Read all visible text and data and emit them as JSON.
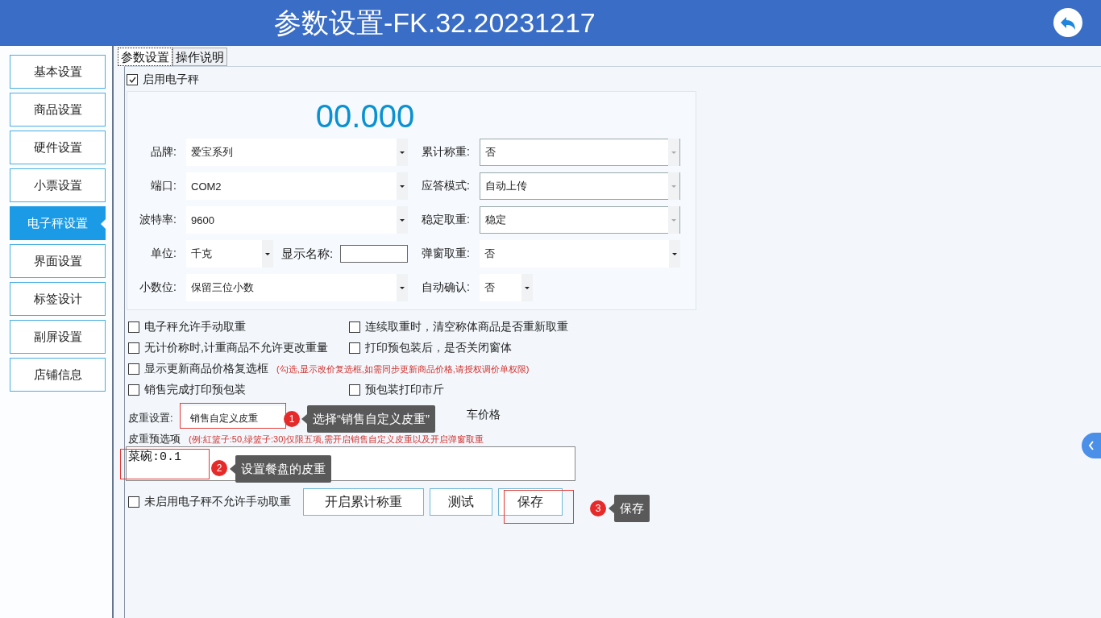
{
  "window": {
    "title": "参数设置-FK.32.20231217"
  },
  "sidebar": {
    "items": [
      {
        "label": "基本设置",
        "selected": false
      },
      {
        "label": "商品设置",
        "selected": false
      },
      {
        "label": "硬件设置",
        "selected": false
      },
      {
        "label": "小票设置",
        "selected": false
      },
      {
        "label": "电子秤设置",
        "selected": true
      },
      {
        "label": "界面设置",
        "selected": false
      },
      {
        "label": "标签设计",
        "selected": false
      },
      {
        "label": "副屏设置",
        "selected": false
      },
      {
        "label": "店铺信息",
        "selected": false
      }
    ]
  },
  "tabs": [
    {
      "label": "参数设置",
      "selected": true
    },
    {
      "label": "操作说明",
      "selected": false
    }
  ],
  "enable_scale": {
    "label": "启用电子秤",
    "checked": true
  },
  "scale_panel": {
    "reading": "00.000",
    "rows": [
      {
        "left": [
          {
            "label": "品牌:",
            "value": "爱宝系列",
            "kind": "combo",
            "disabled": false
          }
        ],
        "right": [
          {
            "label": "累计称重:",
            "value": "否",
            "kind": "combo",
            "disabled": true
          }
        ]
      },
      {
        "left": [
          {
            "label": "端口:",
            "value": "COM2",
            "kind": "combo",
            "disabled": false
          }
        ],
        "right": [
          {
            "label": "应答模式:",
            "value": "自动上传",
            "kind": "combo",
            "disabled": true
          }
        ]
      },
      {
        "left": [
          {
            "label": "波特率:",
            "value": "9600",
            "kind": "combo",
            "disabled": false
          }
        ],
        "right": [
          {
            "label": "稳定取重:",
            "value": "稳定",
            "kind": "combo",
            "disabled": true
          }
        ]
      },
      {
        "left": [
          {
            "label": "单位:",
            "value": "千克",
            "kind": "small_combo",
            "disabled": false
          },
          {
            "label": "显示名称:",
            "kind": "text"
          }
        ],
        "right": [
          {
            "label": "弹窗取重:",
            "value": "否",
            "kind": "combo",
            "disabled": false
          }
        ]
      },
      {
        "left": [
          {
            "label": "小数位:",
            "value": "保留三位小数",
            "kind": "combo",
            "disabled": false
          }
        ],
        "right": [
          {
            "label": "自动确认:",
            "value": "否",
            "kind": "small_combo",
            "disabled": false
          }
        ]
      }
    ]
  },
  "options": [
    [
      {
        "label": "电子秤允许手动取重",
        "checked": false
      },
      {
        "label": "连续取重时，清空称体商品是否重新取重",
        "checked": false
      }
    ],
    [
      {
        "label": "无计价称时,计重商品不允许更改重量",
        "checked": false
      },
      {
        "label": "打印预包装后，是否关闭窗体",
        "checked": false
      }
    ],
    [
      {
        "label": "显示更新商品价格复选框",
        "checked": false,
        "note": "(勾选,显示改价复选框,如需同步更新商品价格,请授权调价单权限)"
      }
    ],
    [
      {
        "label": "销售完成打印预包装",
        "checked": false
      },
      {
        "label": "预包装打印市斤",
        "checked": false
      }
    ]
  ],
  "tare": {
    "label": "皮重设置:",
    "value": "销售自定义皮重",
    "covered_option_text": "车价格"
  },
  "tare_presets": {
    "label": "皮重预选项",
    "note": "(例:紅篮子:50,绿篮子:30)仅限五项,需开启销售自定义皮重以及开启弹窗取重",
    "value": "菜碗:0.1"
  },
  "manual_option": {
    "label": "未启用电子秤不允许手动取重",
    "checked": false
  },
  "buttons": [
    "开启累计称重",
    "测试",
    "保存"
  ],
  "annotations": [
    {
      "number": "1",
      "text": "选择“销售自定义皮重”"
    },
    {
      "number": "2",
      "text": "设置餐盘的皮重"
    },
    {
      "number": "3",
      "text": "保存"
    }
  ]
}
